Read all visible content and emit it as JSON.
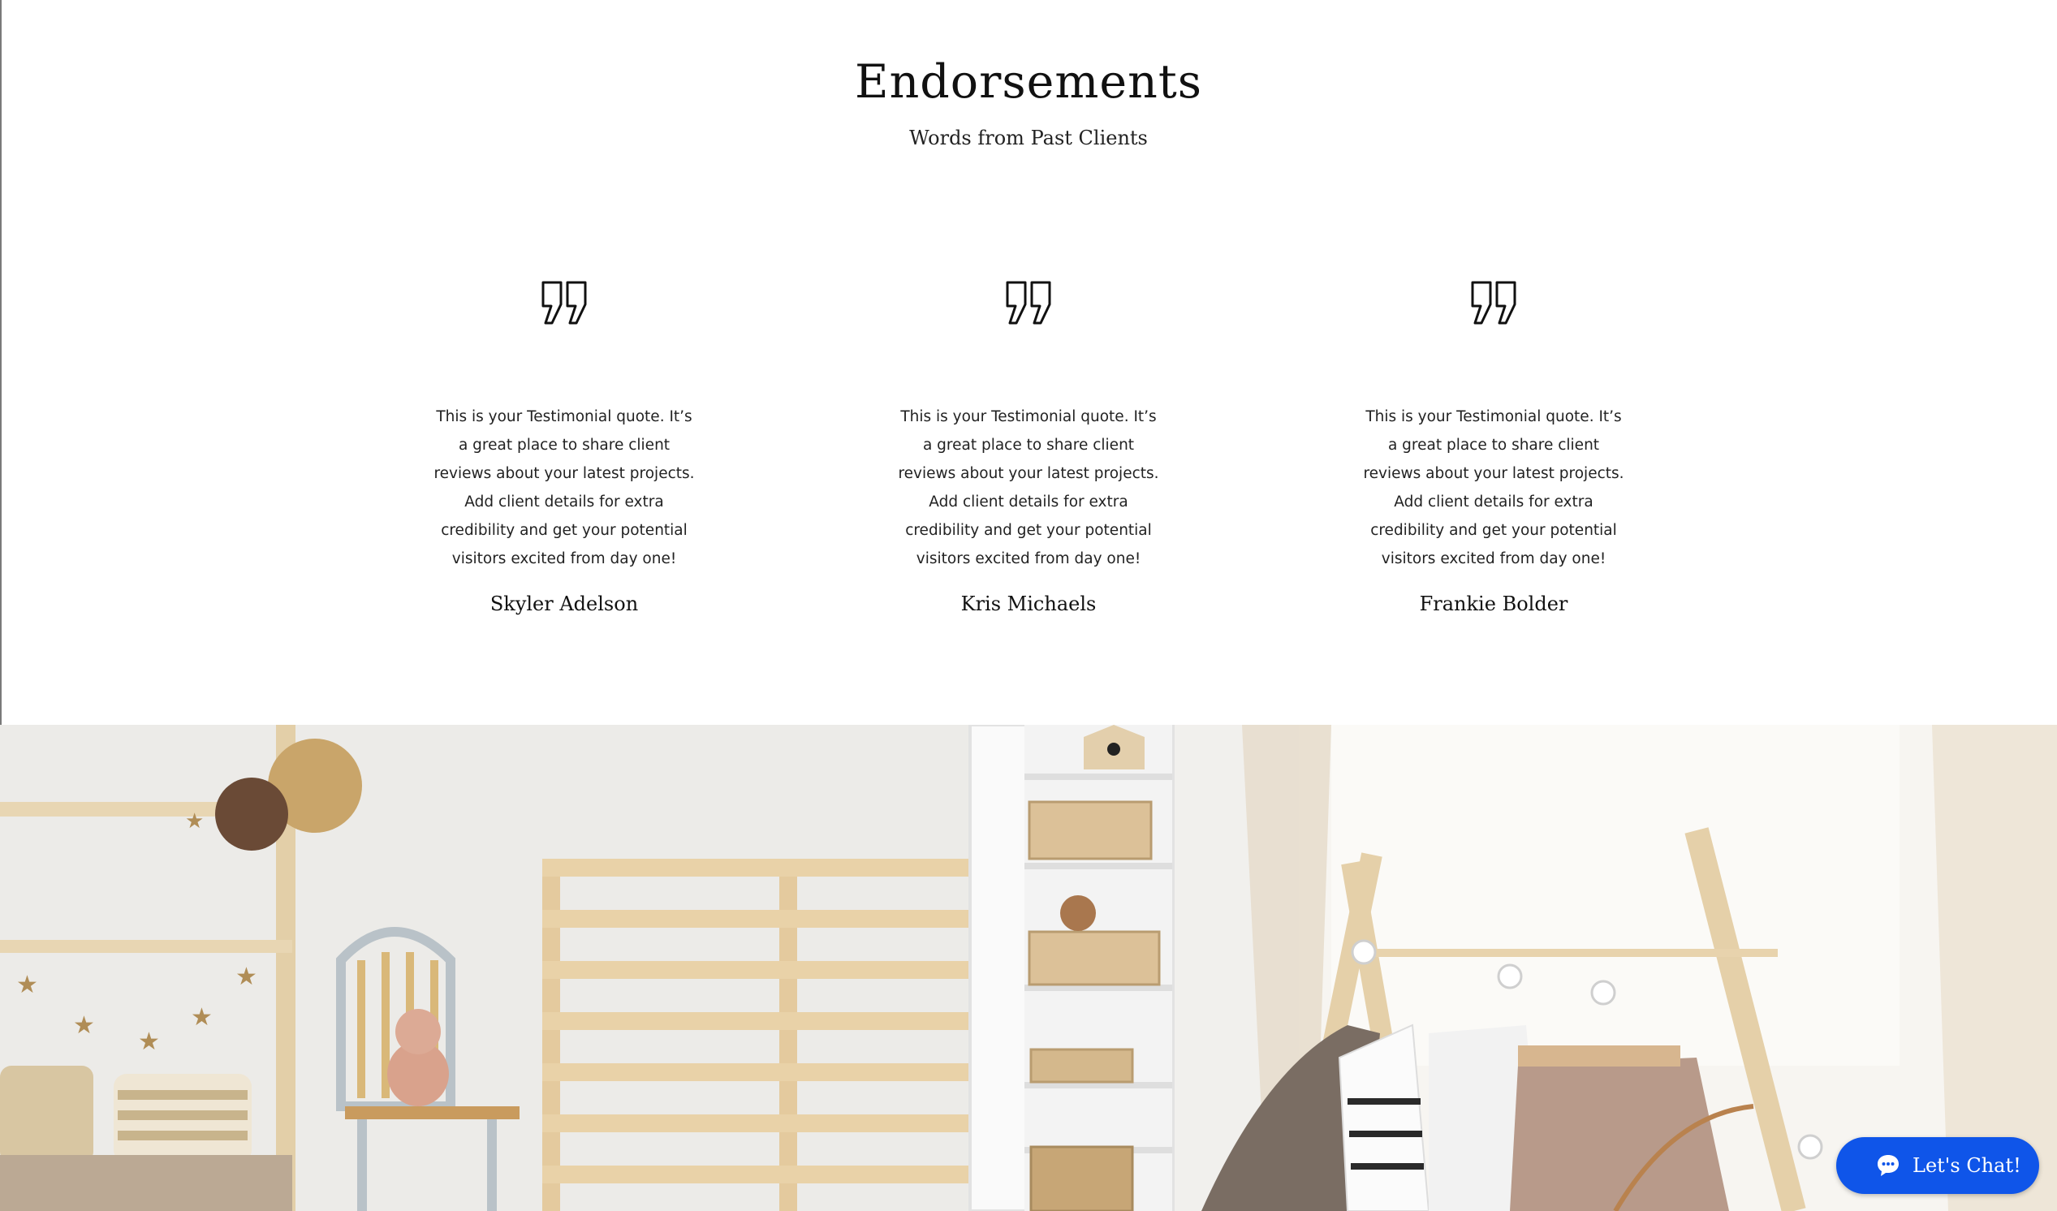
{
  "header": {
    "title": "Endorsements",
    "subtitle": "Words from Past Clients"
  },
  "testimonials": [
    {
      "quote": "This is your Testimonial quote. It’s a great place to share client reviews about your latest projects. Add client details for extra credibility and get your potential visitors excited from day one!",
      "name": "Skyler Adelson"
    },
    {
      "quote": "This is your Testimonial quote. It’s a great place to share client reviews about your latest projects. Add client details for extra credibility and get your potential visitors excited from day one!",
      "name": "Kris Michaels"
    },
    {
      "quote": "This is your Testimonial quote. It’s a great place to share client reviews about your latest projects. Add client details for extra credibility and get your potential visitors excited from day one!",
      "name": "Frankie Bolder"
    }
  ],
  "icons": {
    "quote": "quote-mark-icon",
    "chat": "chat-bubble-icon"
  },
  "chat": {
    "label": "Let's Chat!"
  },
  "colors": {
    "chat_button": "#0f55e9",
    "text": "#111111",
    "background": "#ffffff"
  }
}
